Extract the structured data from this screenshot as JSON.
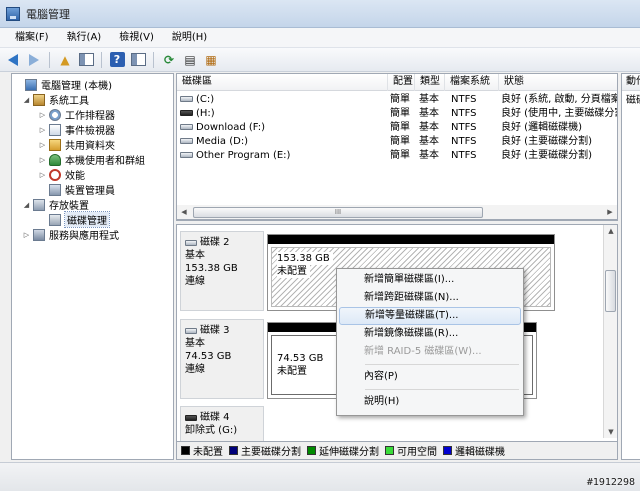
{
  "window": {
    "title": "電腦管理"
  },
  "menu": [
    "檔案(F)",
    "執行(A)",
    "檢視(V)",
    "說明(H)"
  ],
  "toolbar": {
    "icons": [
      "back-arrow-icon",
      "forward-arrow-icon",
      "folder-up-icon",
      "panel-icon",
      "help-icon",
      "list-icon",
      "refresh-icon",
      "properties-icon",
      "export-icon"
    ]
  },
  "tree": [
    {
      "label": "電腦管理 (本機)",
      "icon": "computer-icon",
      "level": 0,
      "expander": ""
    },
    {
      "label": "系統工具",
      "icon": "tools-icon",
      "level": 1,
      "expander": "◢"
    },
    {
      "label": "工作排程器",
      "icon": "clock-icon",
      "level": 2,
      "expander": "▷"
    },
    {
      "label": "事件檢視器",
      "icon": "event-viewer-icon",
      "level": 2,
      "expander": "▷"
    },
    {
      "label": "共用資料夾",
      "icon": "shared-folder-icon",
      "level": 2,
      "expander": "▷"
    },
    {
      "label": "本機使用者和群組",
      "icon": "users-icon",
      "level": 2,
      "expander": "▷"
    },
    {
      "label": "效能",
      "icon": "performance-icon",
      "level": 2,
      "expander": "▷"
    },
    {
      "label": "裝置管理員",
      "icon": "device-manager-icon",
      "level": 2,
      "expander": ""
    },
    {
      "label": "存放裝置",
      "icon": "storage-icon",
      "level": 1,
      "expander": "◢"
    },
    {
      "label": "磁碟管理",
      "icon": "disk-management-icon",
      "level": 2,
      "expander": ""
    },
    {
      "label": "服務與應用程式",
      "icon": "services-icon",
      "level": 1,
      "expander": "▷"
    }
  ],
  "volumes": {
    "columns": [
      "磁碟區",
      "配置",
      "類型",
      "檔案系統",
      "狀態"
    ],
    "rows": [
      {
        "name": "(C:)",
        "layout": "簡單",
        "type": "基本",
        "fs": "NTFS",
        "status": "良好 (系統, 啟動, 分頁檔案, 作用中...",
        "icon": "drive-icon"
      },
      {
        "name": "(H:)",
        "layout": "簡單",
        "type": "基本",
        "fs": "NTFS",
        "status": "良好 (使用中, 主要磁碟分割)",
        "icon": "removable-drive-icon"
      },
      {
        "name": "Download (F:)",
        "layout": "簡單",
        "type": "基本",
        "fs": "NTFS",
        "status": "良好 (邏輯磁碟機)",
        "icon": "drive-icon"
      },
      {
        "name": "Media (D:)",
        "layout": "簡單",
        "type": "基本",
        "fs": "NTFS",
        "status": "良好 (主要磁碟分割)",
        "icon": "drive-icon"
      },
      {
        "name": "Other Program (E:)",
        "layout": "簡單",
        "type": "基本",
        "fs": "NTFS",
        "status": "良好 (主要磁碟分割)",
        "icon": "drive-icon"
      }
    ],
    "scroll_thumb": "III"
  },
  "disks": [
    {
      "name": "磁碟 2",
      "type": "基本",
      "size": "153.38 GB",
      "state": "連線",
      "part_size": "153.38 GB",
      "part_state": "未配置"
    },
    {
      "name": "磁碟 3",
      "type": "基本",
      "size": "74.53 GB",
      "state": "連線",
      "part_size": "74.53 GB",
      "part_state": "未配置"
    },
    {
      "name": "磁碟 4",
      "type": "卸除式 (G:)"
    }
  ],
  "legend": [
    {
      "label": "未配置",
      "color": "#000000"
    },
    {
      "label": "主要磁碟分割",
      "color": "#00007a"
    },
    {
      "label": "延伸磁碟分割",
      "color": "#008a00"
    },
    {
      "label": "可用空間",
      "color": "#3adc3a"
    },
    {
      "label": "邏輯磁碟機",
      "color": "#0000d0"
    }
  ],
  "actions": {
    "header": "動作",
    "item": "磁碟管理"
  },
  "context_menu": {
    "items": [
      {
        "label": "新增簡單磁碟區(I)...",
        "state": "normal"
      },
      {
        "label": "新增跨距磁碟區(N)...",
        "state": "normal"
      },
      {
        "label": "新增等量磁碟區(T)...",
        "state": "highlighted"
      },
      {
        "label": "新增鏡像磁碟區(R)...",
        "state": "normal"
      },
      {
        "label": "新增 RAID-5 磁碟區(W)...",
        "state": "disabled"
      }
    ],
    "properties": "內容(P)",
    "help": "說明(H)"
  },
  "watermark": "#1912298"
}
